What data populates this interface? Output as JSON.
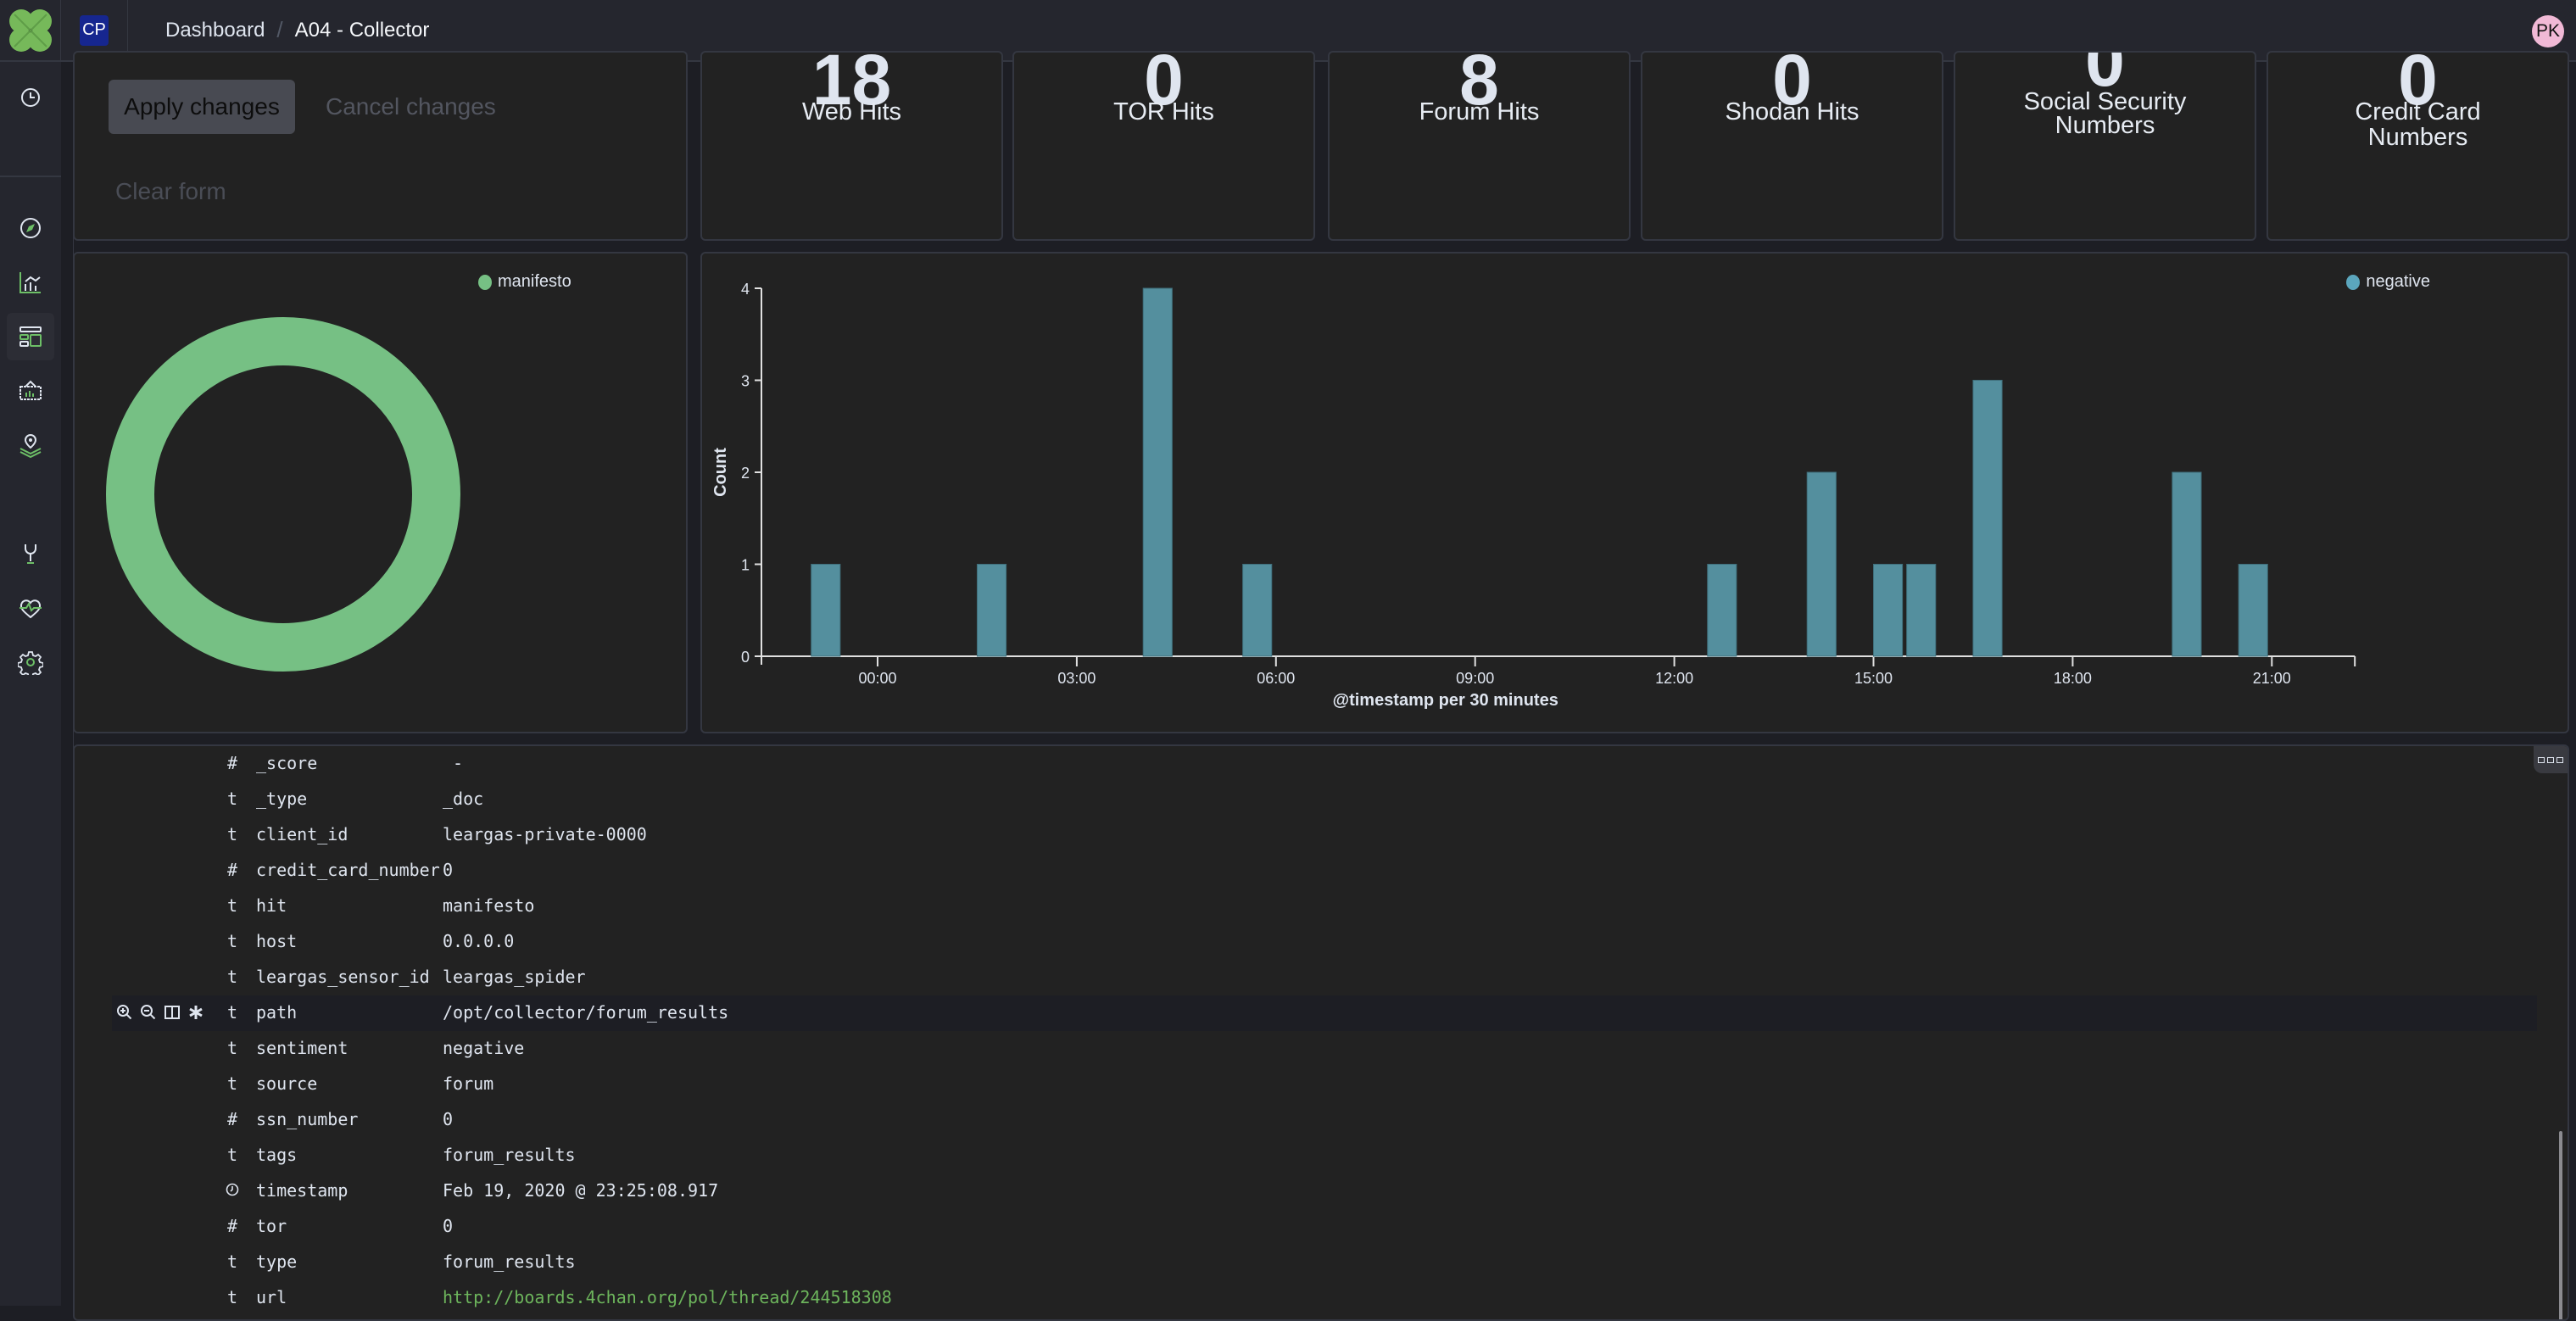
{
  "header": {
    "space_initials": "CP",
    "breadcrumb": [
      "Dashboard",
      "A04 - Collector"
    ],
    "user_initials": "PK"
  },
  "sidebar": {
    "items": [
      {
        "icon": "clock-icon",
        "label": "Recently viewed"
      },
      {
        "icon": "compass-icon",
        "label": "Discover"
      },
      {
        "icon": "visualize-icon",
        "label": "Visualize"
      },
      {
        "icon": "dashboard-icon",
        "label": "Dashboard",
        "active": true
      },
      {
        "icon": "canvas-icon",
        "label": "Canvas"
      },
      {
        "icon": "maps-icon",
        "label": "Maps"
      },
      {
        "icon": "wrench-icon",
        "label": "Dev Tools"
      },
      {
        "icon": "heartbeat-icon",
        "label": "Stack Monitoring"
      },
      {
        "icon": "gear-icon",
        "label": "Stack Management"
      }
    ]
  },
  "controls": {
    "apply": "Apply changes",
    "cancel": "Cancel changes",
    "clear": "Clear form"
  },
  "stats": [
    {
      "value": "18",
      "label": "Web Hits"
    },
    {
      "value": "0",
      "label": "TOR Hits"
    },
    {
      "value": "8",
      "label": "Forum Hits"
    },
    {
      "value": "0",
      "label": "Shodan Hits"
    },
    {
      "value": "0",
      "label": "Social Security Numbers"
    },
    {
      "value": "0",
      "label": "Credit Card Numbers"
    }
  ],
  "colors": {
    "accent_green": "#6dbf67",
    "donut": "#76c084",
    "bar": "#548f9e",
    "legend_negative": "#5ba6bd",
    "link": "#6db55c"
  },
  "chart_data": [
    {
      "type": "pie",
      "donut": true,
      "title": "",
      "legend": "top-right",
      "slices": [
        {
          "label": "manifesto",
          "value": 1
        }
      ]
    },
    {
      "type": "bar",
      "title": "",
      "xlabel": "@timestamp per 30 minutes",
      "ylabel": "Count",
      "ylim": [
        0,
        4
      ],
      "yticks": [
        "0",
        "1",
        "2",
        "3",
        "4"
      ],
      "xticks": [
        "00:00",
        "03:00",
        "06:00",
        "09:00",
        "12:00",
        "15:00",
        "18:00",
        "21:00"
      ],
      "xrange_hours": [
        -1.8,
        22.25
      ],
      "legend": "top-right",
      "series": [
        {
          "name": "negative",
          "points": [
            {
              "x": "23:00",
              "hour": -1.0,
              "value": 1
            },
            {
              "x": "01:30",
              "hour": 1.5,
              "value": 1
            },
            {
              "x": "04:00",
              "hour": 4.0,
              "value": 4
            },
            {
              "x": "05:30",
              "hour": 5.5,
              "value": 1
            },
            {
              "x": "12:30",
              "hour": 12.5,
              "value": 1
            },
            {
              "x": "14:00",
              "hour": 14.0,
              "value": 2
            },
            {
              "x": "15:00",
              "hour": 15.0,
              "value": 1
            },
            {
              "x": "15:30",
              "hour": 15.5,
              "value": 1
            },
            {
              "x": "16:30",
              "hour": 16.5,
              "value": 3
            },
            {
              "x": "19:30",
              "hour": 19.5,
              "value": 2
            },
            {
              "x": "20:30",
              "hour": 20.5,
              "value": 1
            }
          ]
        }
      ]
    }
  ],
  "document": {
    "fields": [
      {
        "type": "#",
        "name": "_score",
        "value": " -"
      },
      {
        "type": "t",
        "name": "_type",
        "value": "_doc"
      },
      {
        "type": "t",
        "name": "client_id",
        "value": "leargas-private-0000"
      },
      {
        "type": "#",
        "name": "credit_card_number",
        "value": "0"
      },
      {
        "type": "t",
        "name": "hit",
        "value": "manifesto"
      },
      {
        "type": "t",
        "name": "host",
        "value": "0.0.0.0"
      },
      {
        "type": "t",
        "name": "leargas_sensor_id",
        "value": "leargas_spider"
      },
      {
        "type": "t",
        "name": "path",
        "value": "/opt/collector/forum_results",
        "highlighted": true
      },
      {
        "type": "t",
        "name": "sentiment",
        "value": "negative"
      },
      {
        "type": "t",
        "name": "source",
        "value": "forum"
      },
      {
        "type": "#",
        "name": "ssn_number",
        "value": "0"
      },
      {
        "type": "t",
        "name": "tags",
        "value": "forum_results"
      },
      {
        "type": "clock",
        "name": "timestamp",
        "value": "Feb 19, 2020 @ 23:25:08.917"
      },
      {
        "type": "#",
        "name": "tor",
        "value": "0"
      },
      {
        "type": "t",
        "name": "type",
        "value": "forum_results"
      },
      {
        "type": "t",
        "name": "url",
        "value": "http://boards.4chan.org/pol/thread/244518308",
        "link": true
      }
    ],
    "row_actions": [
      "zoom-in-icon",
      "zoom-out-icon",
      "toggle-column-icon",
      "filter-exists-icon"
    ]
  }
}
